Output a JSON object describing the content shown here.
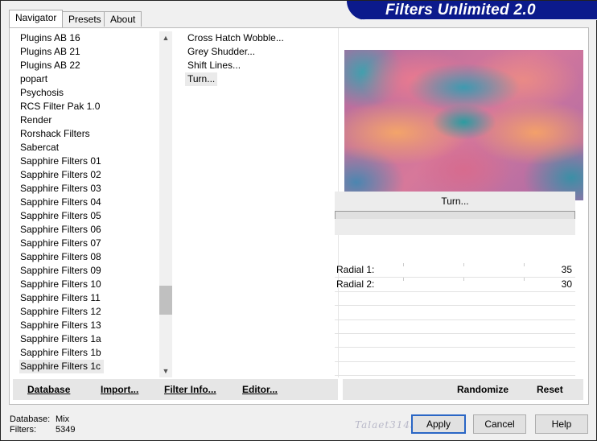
{
  "tabs": [
    "Navigator",
    "Presets",
    "About"
  ],
  "banner": {
    "title": "Filters Unlimited 2.0"
  },
  "categories": [
    "Plugins AB 16",
    "Plugins AB 21",
    "Plugins AB 22",
    "popart",
    "Psychosis",
    "RCS Filter Pak 1.0",
    "Render",
    "Rorshack Filters",
    "Sabercat",
    "Sapphire Filters 01",
    "Sapphire Filters 02",
    "Sapphire Filters 03",
    "Sapphire Filters 04",
    "Sapphire Filters 05",
    "Sapphire Filters 06",
    "Sapphire Filters 07",
    "Sapphire Filters 08",
    "Sapphire Filters 09",
    "Sapphire Filters 10",
    "Sapphire Filters 11",
    "Sapphire Filters 12",
    "Sapphire Filters 13",
    "Sapphire Filters 1a",
    "Sapphire Filters 1b",
    "Sapphire Filters 1c"
  ],
  "selected_category": "Sapphire Filters 1c",
  "filters": [
    "Cross Hatch Wobble...",
    "Grey Shudder...",
    "Shift Lines...",
    "Turn..."
  ],
  "selected_filter": "Turn...",
  "current_filter_title": "Turn...",
  "params": [
    {
      "label": "Radial 1:",
      "value": "35"
    },
    {
      "label": "Radial 2:",
      "value": "30"
    }
  ],
  "left_buttons": {
    "database": "Database",
    "import": "Import...",
    "filter_info": "Filter Info...",
    "editor": "Editor..."
  },
  "right_buttons": {
    "randomize": "Randomize",
    "reset": "Reset"
  },
  "footer": {
    "database_label": "Database:",
    "database_value": "Mix",
    "filters_label": "Filters:",
    "filters_value": "5349",
    "watermark": "Talaet3145"
  },
  "dialog_buttons": {
    "apply": "Apply",
    "cancel": "Cancel",
    "help": "Help"
  },
  "colors": {
    "banner": "#0b1a8c",
    "default_button_border": "#2a66c5",
    "selection": "#eaeaea"
  },
  "icons": {
    "scroll_up": "triangle-up",
    "scroll_down": "triangle-down"
  }
}
